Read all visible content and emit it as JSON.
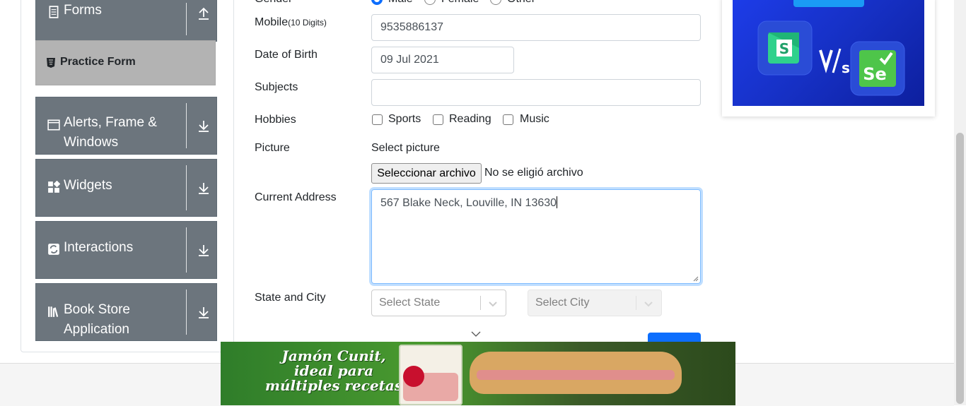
{
  "sidebar": {
    "groups": [
      {
        "label": "Forms"
      },
      {
        "label": "Alerts, Frame & Windows"
      },
      {
        "label": "Widgets"
      },
      {
        "label": "Interactions"
      },
      {
        "label": "Book Store Application"
      }
    ],
    "active_item": "Practice Form"
  },
  "form": {
    "gender": {
      "label": "Gender",
      "options": [
        "Male",
        "Female",
        "Other"
      ],
      "selected": "Male"
    },
    "mobile": {
      "label": "Mobile",
      "hint": "(10 Digits)",
      "value": "9535886137"
    },
    "dob": {
      "label": "Date of Birth",
      "value": "09 Jul 2021"
    },
    "subjects": {
      "label": "Subjects",
      "value": ""
    },
    "hobbies": {
      "label": "Hobbies",
      "options": [
        "Sports",
        "Reading",
        "Music"
      ]
    },
    "picture": {
      "label": "Picture",
      "prompt": "Select picture",
      "button": "Seleccionar archivo",
      "status": "No se eligió archivo"
    },
    "address": {
      "label": "Current Address",
      "value": "567 Blake Neck, Louville, IN 13630"
    },
    "state_city": {
      "label": "State and City",
      "state_placeholder": "Select State",
      "city_placeholder": "Select City"
    }
  },
  "banner": {
    "line1": "Jamón Cunit,",
    "line2": "ideal para",
    "line3": "múltiples recetas"
  },
  "colors": {
    "accent": "#0d6efd",
    "sidebar_group": "#6c757d",
    "active_item": "#b3b3b3"
  }
}
